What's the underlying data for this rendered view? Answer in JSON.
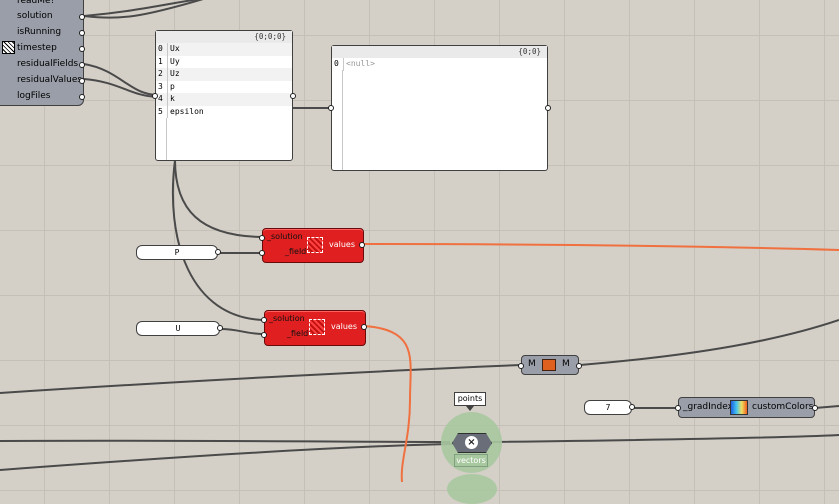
{
  "left_component": {
    "outputs": [
      "readMe!",
      "solution",
      "isRunning",
      "timestep",
      "residualFields",
      "residualValues",
      "logFiles"
    ]
  },
  "fields_panel": {
    "header": "{0;0;0}",
    "rows": [
      {
        "index": "0",
        "value": "Ux"
      },
      {
        "index": "1",
        "value": "Uy"
      },
      {
        "index": "2",
        "value": "Uz"
      },
      {
        "index": "3",
        "value": "p"
      },
      {
        "index": "4",
        "value": "k"
      },
      {
        "index": "5",
        "value": "epsilon"
      }
    ]
  },
  "null_panel": {
    "header": "{0;0}",
    "row_index": "0",
    "row_value": "<null>"
  },
  "probe_p": {
    "input_solution": "_solution",
    "input_field": "_field",
    "output": "values",
    "field_value": "P"
  },
  "probe_u": {
    "input_solution": "_solution",
    "input_field": "_field",
    "output": "values",
    "field_value": "U"
  },
  "merge_component": {
    "input": "M",
    "output": "M"
  },
  "gradient_component": {
    "input": "_gradIndex",
    "output": "customColors",
    "index_value": "7"
  },
  "vector_component": {
    "top_label": "points",
    "bottom_label": "vectors"
  },
  "colors": {
    "canvas": "#d4d0c8",
    "component": "#9a9ea8",
    "error_component": "#e02020",
    "active_wire": "#f07040",
    "wire": "#404040"
  }
}
